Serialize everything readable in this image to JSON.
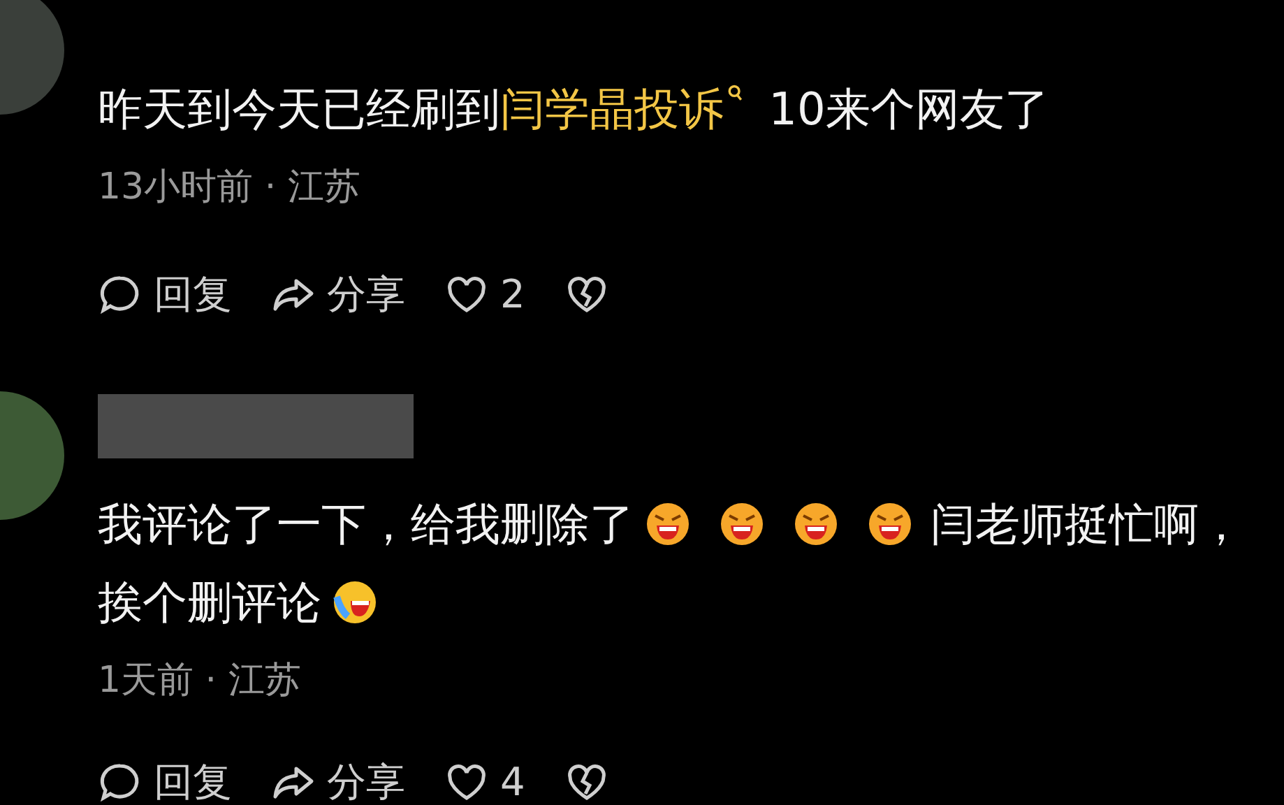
{
  "comments": [
    {
      "username_hidden": false,
      "segments": [
        {
          "kind": "text",
          "text": "昨天到今天已经刷到"
        },
        {
          "kind": "link",
          "text": "闫学晶投诉"
        },
        {
          "kind": "text",
          "text": " 10来个网友了"
        }
      ],
      "meta": "13小时前 · 江苏",
      "actions": {
        "reply": "回复",
        "share": "分享",
        "likes": "2"
      }
    },
    {
      "username_hidden": true,
      "segments": [
        {
          "kind": "text",
          "text": "我评论了一下，给我删除了"
        },
        {
          "kind": "angry"
        },
        {
          "kind": "angry"
        },
        {
          "kind": "angry"
        },
        {
          "kind": "angry"
        },
        {
          "kind": "text",
          "text": "闫老师挺忙啊，挨个删评论"
        },
        {
          "kind": "crylaugh"
        }
      ],
      "meta": "1天前 · 江苏",
      "actions": {
        "reply": "回复",
        "share": "分享",
        "likes": "4"
      }
    }
  ]
}
